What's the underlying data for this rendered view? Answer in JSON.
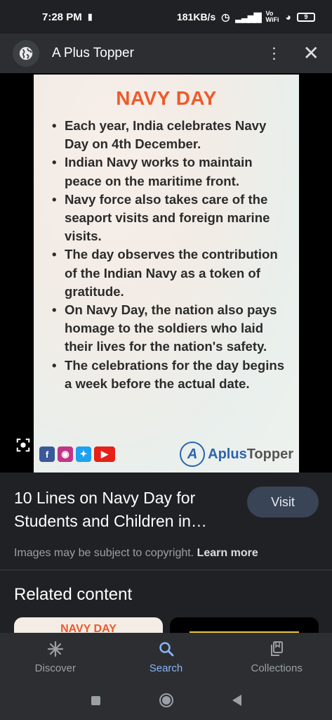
{
  "status_bar": {
    "time": "7:28 PM",
    "network_speed": "181KB/s",
    "wifi_label": "Vo WiFi",
    "battery": "9"
  },
  "title_bar": {
    "site_title": "A Plus Topper",
    "globe_icon": "globe-icon",
    "menu_icon": "more-vert-icon",
    "close_icon": "close-icon"
  },
  "poster": {
    "title": "NAVY DAY",
    "bullets": [
      "Each year, India celebrates Navy Day on 4th December.",
      "Indian Navy works to maintain peace on the maritime front.",
      "Navy force also takes care of the seaport visits and foreign marine visits.",
      "The day observes the contribution of the Indian Navy as a token of gratitude.",
      "On Navy Day, the nation also pays homage to the soldiers who laid their lives for the nation's safety.",
      "The celebrations for the day begins a week before the actual date."
    ],
    "brand_part1": "Aplus",
    "brand_part2": "Topper",
    "brand_logo_letter": "A",
    "social_icons": [
      "facebook-icon",
      "instagram-icon",
      "twitter-icon",
      "youtube-icon"
    ]
  },
  "result": {
    "title": "10 Lines on Navy Day for Students and Children in…",
    "visit_label": "Visit",
    "copyright_text": "Images may be subject to copyright.",
    "learn_more": "Learn more"
  },
  "related": {
    "heading": "Related content",
    "thumb1_text": "NAVY DAY"
  },
  "bottom_nav": {
    "items": [
      {
        "label": "Discover",
        "icon": "asterisk-icon",
        "active": false
      },
      {
        "label": "Search",
        "icon": "search-icon",
        "active": true
      },
      {
        "label": "Collections",
        "icon": "collections-icon",
        "active": false
      }
    ]
  },
  "colors": {
    "accent": "#8ab4f8",
    "poster_title": "#ef5a2a",
    "brand_blue": "#2a64b0",
    "background": "#202124"
  }
}
